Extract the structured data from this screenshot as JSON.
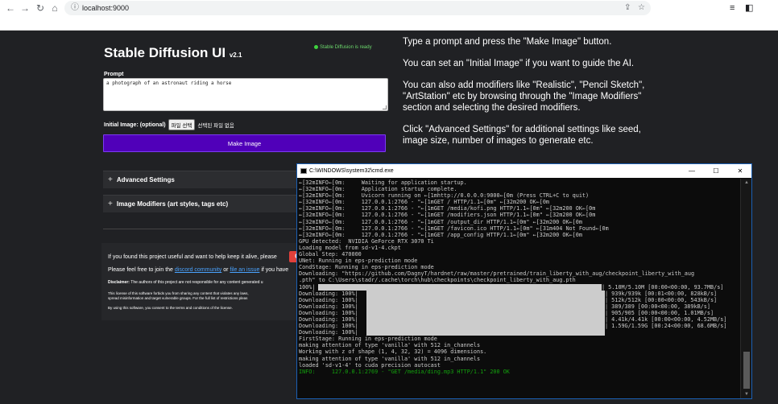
{
  "browser": {
    "url": "localhost:9000"
  },
  "app": {
    "title": "Stable Diffusion UI",
    "version": "v2.1",
    "status": "Stable Diffusion is ready",
    "prompt_label": "Prompt",
    "prompt_value": "a photograph of an astronaut riding a horse",
    "initial_image_label": "Initial Image: (optional)",
    "file_button": "파일 선택",
    "file_none": "선택된 파일 없음",
    "make_image": "Make Image",
    "advanced_settings": "Advanced Settings",
    "image_modifiers": "Image Modifiers (art styles, tags etc)",
    "panel_toggle": "+",
    "coffee_label": "C"
  },
  "support": {
    "line1": "If you found this project useful and want to help keep it alive, please",
    "line2_pre": "Please feel free to join the",
    "discord": "discord community",
    "or": "or",
    "issue": "file an issue",
    "line2_post": "if you have",
    "disclaimer_label": "Disclaimer:",
    "disclaimer": "The authors of this project are not responsible for any content generated u",
    "license_1": "This license of this software forbids you from sharing any content that violates any laws,",
    "license_2": "spread misinformation and target vulnerable groups. For the full list of restrictions pleas",
    "consent": "By using this software, you consent to the terms and conditions of the license."
  },
  "help": [
    "Type a prompt and press the \"Make Image\" button.",
    "You can set an \"Initial Image\" if you want to guide the AI.",
    "You can also add modifiers like \"Realistic\", \"Pencil Sketch\", \"ArtStation\" etc by browsing through the \"Image Modifiers\" section and selecting the desired modifiers.",
    "Click \"Advanced Settings\" for additional settings like seed, image size, number of images to generate etc."
  ],
  "cmd": {
    "title": "C:\\WINDOWS\\system32\\cmd.exe",
    "lines": [
      "←[32mINFO←[0m:     Waiting for application startup.",
      "←[32mINFO←[0m:     Application startup complete.",
      "←[32mINFO←[0m:     Uvicorn running on ←[1mhttp://0.0.0.0:9000←[0m (Press CTRL+C to quit)",
      "←[32mINFO←[0m:     127.0.0.1:2766 - \"←[1mGET / HTTP/1.1←[0m\" ←[32m200 OK←[0m",
      "←[32mINFO←[0m:     127.0.0.1:2766 - \"←[1mGET /media/kofi.png HTTP/1.1←[0m\" ←[32m200 OK←[0m",
      "←[32mINFO←[0m:     127.0.0.1:2766 - \"←[1mGET /modifiers.json HTTP/1.1←[0m\" ←[32m200 OK←[0m",
      "←[32mINFO←[0m:     127.0.0.1:2766 - \"←[1mGET /output_dir HTTP/1.1←[0m\" ←[32m200 OK←[0m",
      "←[32mINFO←[0m:     127.0.0.1:2766 - \"←[1mGET /favicon.ico HTTP/1.1←[0m\" ←[31m404 Not Found←[0m",
      "←[32mINFO←[0m:     127.0.0.1:2766 - \"←[1mGET /app_config HTTP/1.1←[0m\" ←[32m200 OK←[0m",
      "GPU detected:  NVIDIA GeForce RTX 3070 Ti",
      "Loading model from sd-v1-4.ckpt",
      "Global Step: 470000",
      "UNet: Running in eps-prediction mode",
      "CondStage: Running in eps-prediction mode",
      "Downloading: \"https://github.com/DagnyT/hardnet/raw/master/pretrained/train_liberty_with_aug/checkpoint_liberty_with_aug",
      ".pth\" to C:\\Users\\stadr/.cache\\torch\\hub\\checkpoints\\checkpoint_liberty_with_aug.pth",
      "100%|",
      "Downloading: 100%|",
      "Downloading: 100%|",
      "Downloading: 100%|",
      "Downloading: 100%|",
      "Downloading: 100%|",
      "Downloading: 100%|",
      "Downloading: 100%|",
      "FirstStage: Running in eps-prediction mode",
      "making attention of type 'vanilla' with 512 in_channels",
      "Working with z of shape (1, 4, 32, 32) = 4096 dimensions.",
      "making attention of type 'vanilla' with 512 in_channels",
      "loaded 'sd-v1-4' to cuda precision autocast",
      "INFO:     127.0.0.1:2769 - \"GET /media/ding.mp3 HTTP/1.1\" 200 OK"
    ],
    "progress_suffixes": [
      "| 5.10M/5.10M [00:00<00:00, 93.7MB/s]",
      "| 939k/939k [00:01<00:00, 828kB/s]",
      "| 512k/512k [00:00<00:00, 543kB/s]",
      "| 389/389 [00:00<00:00, 389kB/s]",
      "| 905/905 [00:00<00:00, 1.01MB/s]",
      "| 4.41k/4.41k [00:00<00:00, 4.52MB/s]",
      "| 1.59G/1.59G [00:24<00:00, 68.6MB/s]",
      ""
    ]
  }
}
